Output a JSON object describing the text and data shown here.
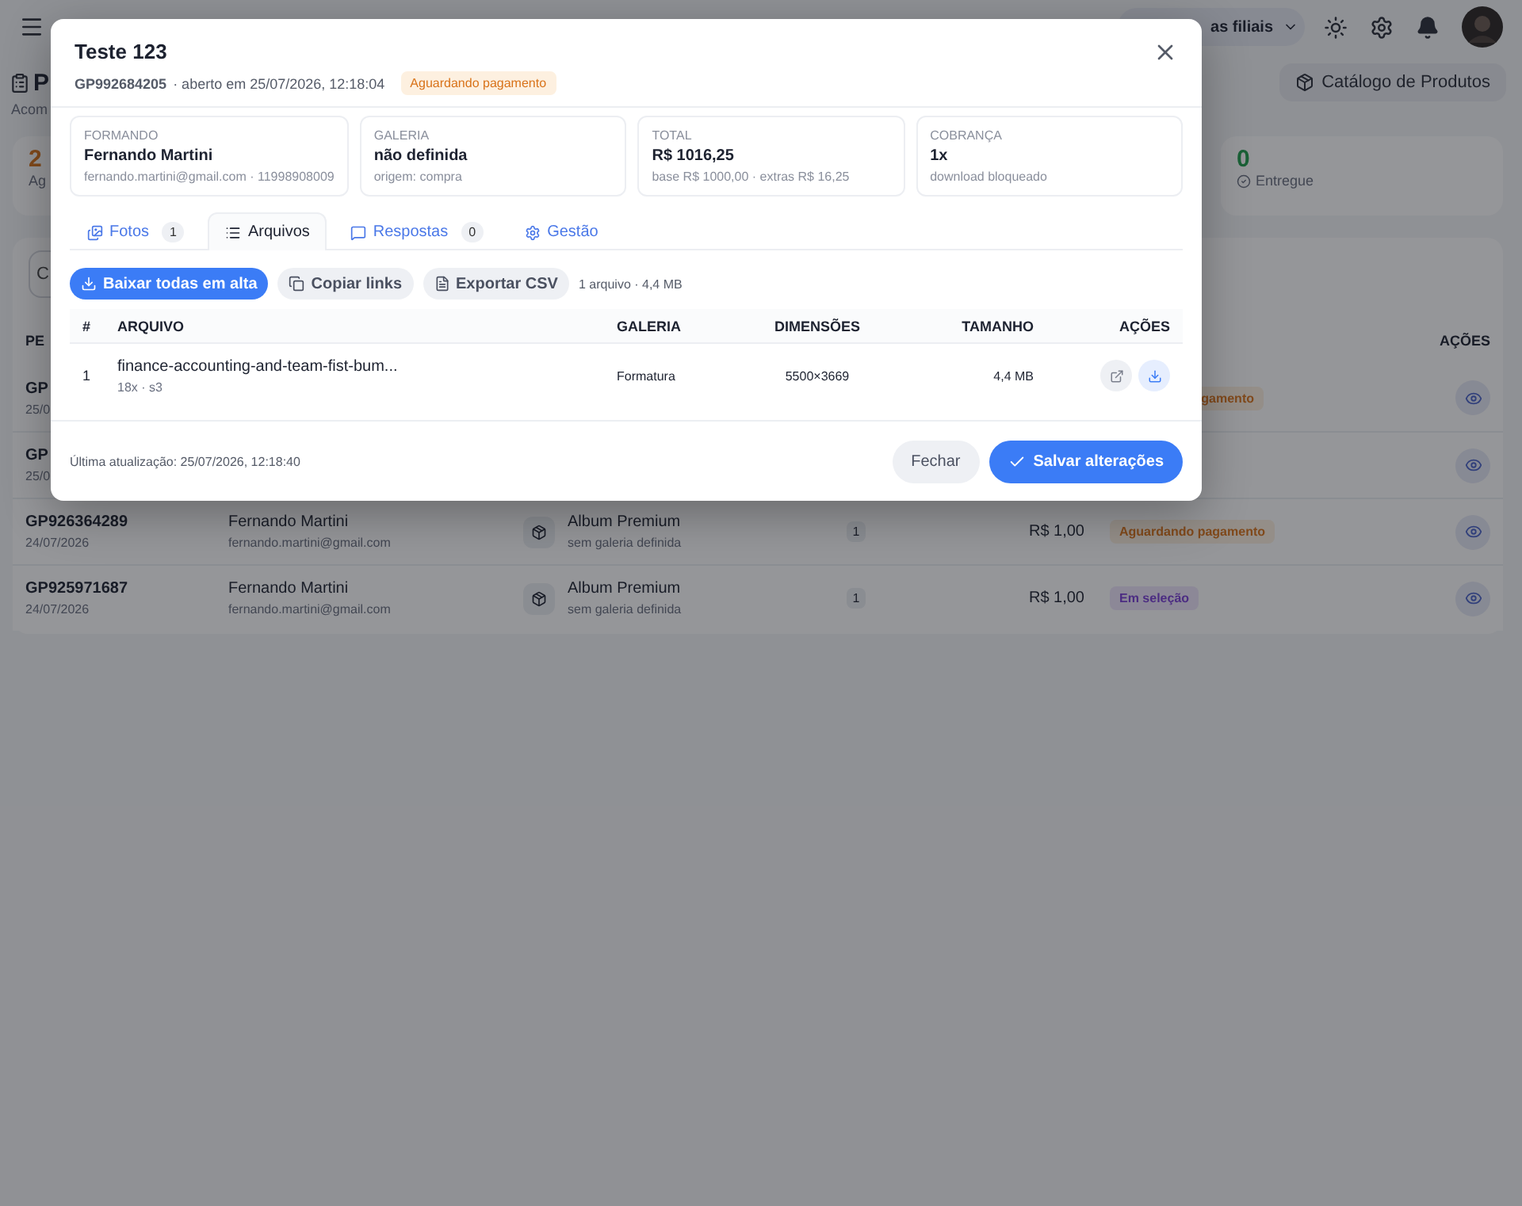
{
  "header": {
    "branch_selector": "as filiais"
  },
  "page": {
    "title": "P",
    "subtitle": "Acom",
    "catalog_button": "Catálogo de Produtos"
  },
  "stats": [
    {
      "value": "2",
      "label": "Ag",
      "kind": "pending"
    },
    {
      "value": "0",
      "label": "Entregue",
      "kind": "delivered"
    }
  ],
  "filter": {
    "placeholder": "C"
  },
  "orders_table": {
    "columns": [
      "PE",
      "AÇÕES"
    ],
    "rows": [
      {
        "order": "GP",
        "date": "25/0",
        "status": {
          "label": "gamento",
          "kind": "pending"
        }
      },
      {
        "order": "GP",
        "date": "25/0"
      },
      {
        "order": "GP926364289",
        "date": "24/07/2026",
        "customer": "Fernando Martini",
        "email": "fernando.martini@gmail.com",
        "product": "Album Premium",
        "gallery": "sem galeria definida",
        "quantity": "1",
        "price": "R$ 1,00",
        "status": {
          "label": "Aguardando pagamento",
          "kind": "pending"
        }
      },
      {
        "order": "GP925971687",
        "date": "24/07/2026",
        "customer": "Fernando Martini",
        "email": "fernando.martini@gmail.com",
        "product": "Album Premium",
        "gallery": "sem galeria definida",
        "quantity": "1",
        "price": "R$ 1,00",
        "status": {
          "label": "Em seleção",
          "kind": "selecting"
        }
      }
    ]
  },
  "modal": {
    "title": "Teste 123",
    "order_id": "GP992684205",
    "opened": "· aberto em 25/07/2026, 12:18:04",
    "status": {
      "label": "Aguardando pagamento",
      "kind": "pending"
    },
    "info_cards": [
      {
        "label": "FORMANDO",
        "value": "Fernando Martini",
        "detail": "fernando.martini@gmail.com · 11998908009"
      },
      {
        "label": "GALERIA",
        "value": "não definida",
        "detail": "origem: compra"
      },
      {
        "label": "TOTAL",
        "value": "R$ 1016,25",
        "detail": "base R$ 1000,00 · extras R$ 16,25"
      },
      {
        "label": "COBRANÇA",
        "value": "1x",
        "detail": "download bloqueado"
      }
    ],
    "tabs": [
      {
        "label": "Fotos",
        "count": "1",
        "selected": false
      },
      {
        "label": "Arquivos",
        "selected": true
      },
      {
        "label": "Respostas",
        "count": "0",
        "selected": false
      },
      {
        "label": "Gestão",
        "selected": false
      }
    ],
    "toolbar": {
      "buttons": [
        {
          "label": "Baixar todas em alta",
          "kind": "primary"
        },
        {
          "label": "Copiar links",
          "kind": "secondary"
        },
        {
          "label": "Exportar CSV",
          "kind": "secondary"
        }
      ],
      "summary": "1 arquivo · 4,4 MB"
    },
    "files_table": {
      "columns": [
        "#",
        "ARQUIVO",
        "GALERIA",
        "DIMENSÕES",
        "TAMANHO",
        "AÇÕES"
      ],
      "rows": [
        {
          "index": "1",
          "name": "finance-accounting-and-team-fist-bum...",
          "meta": "18x · s3",
          "gallery": "Formatura",
          "dimensions": "5500×3669",
          "size": "4,4 MB"
        }
      ]
    },
    "footer": {
      "updated": "Última atualização: 25/07/2026, 12:18:40",
      "buttons": [
        {
          "label": "Fechar",
          "kind": "secondary"
        },
        {
          "label": "Salvar alterações",
          "kind": "primary"
        }
      ]
    }
  }
}
